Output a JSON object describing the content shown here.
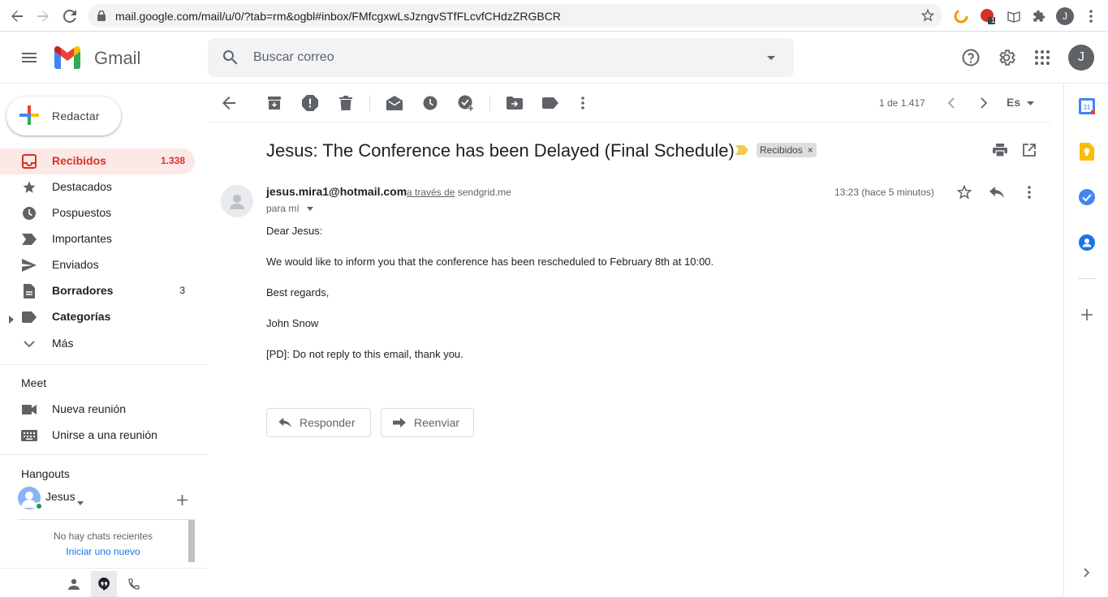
{
  "browser": {
    "url": "mail.google.com/mail/u/0/?tab=rm&ogbl#inbox/FMfcgxwLsJzngvSTfFLcvfCHdzZRGBCR",
    "profile_initial": "J",
    "ext_badge": "1"
  },
  "header": {
    "app_name": "Gmail",
    "search_placeholder": "Buscar correo",
    "account_initial": "J"
  },
  "sidebar": {
    "compose_label": "Redactar",
    "items": [
      {
        "label": "Recibidos",
        "count": "1.338",
        "icon": "inbox-icon"
      },
      {
        "label": "Destacados",
        "count": "",
        "icon": "star-icon"
      },
      {
        "label": "Pospuestos",
        "count": "",
        "icon": "clock-icon"
      },
      {
        "label": "Importantes",
        "count": "",
        "icon": "important-icon"
      },
      {
        "label": "Enviados",
        "count": "",
        "icon": "send-icon"
      },
      {
        "label": "Borradores",
        "count": "3",
        "icon": "draft-icon"
      },
      {
        "label": "Categorías",
        "count": "",
        "icon": "label-icon"
      },
      {
        "label": "Más",
        "count": "",
        "icon": "chevron-down-icon"
      }
    ],
    "meet": {
      "title": "Meet",
      "new_meeting": "Nueva reunión",
      "join_meeting": "Unirse a una reunión"
    },
    "hangouts": {
      "title": "Hangouts",
      "user": "Jesus",
      "no_chats": "No hay chats recientes",
      "start_new": "Iniciar uno nuevo"
    }
  },
  "toolbar": {
    "pager": "1 de 1.417",
    "lang": "Es"
  },
  "email": {
    "subject": "Jesus: The Conference has been Delayed (Final Schedule)",
    "label": "Recibidos",
    "label_remove": "×",
    "sender": "jesus.mira1@hotmail.com",
    "via_text": "a través de",
    "via_domain": "sendgrid.me",
    "to": "para mí",
    "time": "13:23 (hace 5 minutos)",
    "body": [
      "Dear Jesus:",
      "We would like to inform you that the conference has been rescheduled to February 8th at 10:00.",
      "Best regards,",
      "John Snow",
      "[PD]: Do not reply to this email, thank you."
    ],
    "reply_label": "Responder",
    "forward_label": "Reenviar"
  },
  "colors": {
    "active_red": "#d93025",
    "active_bg": "#fce8e6",
    "link_blue": "#1a73e8"
  }
}
